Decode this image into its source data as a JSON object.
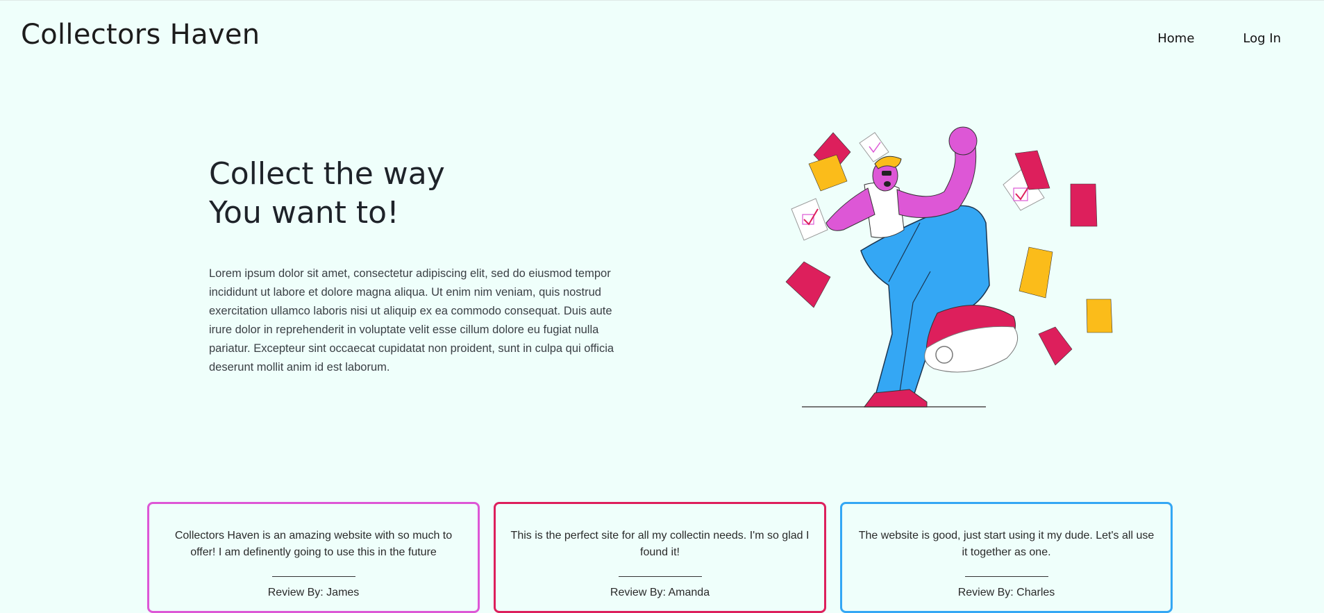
{
  "header": {
    "brand": "Collectors Haven",
    "nav": {
      "home": "Home",
      "login": "Log In"
    }
  },
  "hero": {
    "title_line1": "Collect the way",
    "title_line2": "You want to!",
    "body": "Lorem ipsum dolor sit amet, consectetur adipiscing elit, sed do eiusmod tempor incididunt ut labore et dolore magna aliqua. Ut enim nim veniam, quis nostrud exercitation ullamco laboris nisi ut aliquip ex ea commodo consequat. Duis aute irure dolor in reprehenderit in voluptate velit esse cillum dolore eu fugiat nulla pariatur. Excepteur sint occaecat cupidatat non proident, sunt in culpa qui officia deserunt mollit anim id est laborum.",
    "illustration": "person-dancing-with-papers-illustration"
  },
  "reviews": [
    {
      "text": "Collectors Haven is an amazing website with so much to offer! I am definently going to use this in the future",
      "by": "Review By: James",
      "color": "#dd57d6"
    },
    {
      "text": "This is the perfect site for all my collectin needs. I'm so glad I found it!",
      "by": "Review By: Amanda",
      "color": "#dd1f5c"
    },
    {
      "text": "The website is good, just start using it my dude. Let's all use it together as one.",
      "by": "Review By: Charles",
      "color": "#34a7f4"
    }
  ],
  "colors": {
    "background": "#effffb",
    "pink": "#dd57d6",
    "red": "#dd1f5c",
    "blue": "#34a7f4",
    "yellow": "#fbbc1a"
  }
}
